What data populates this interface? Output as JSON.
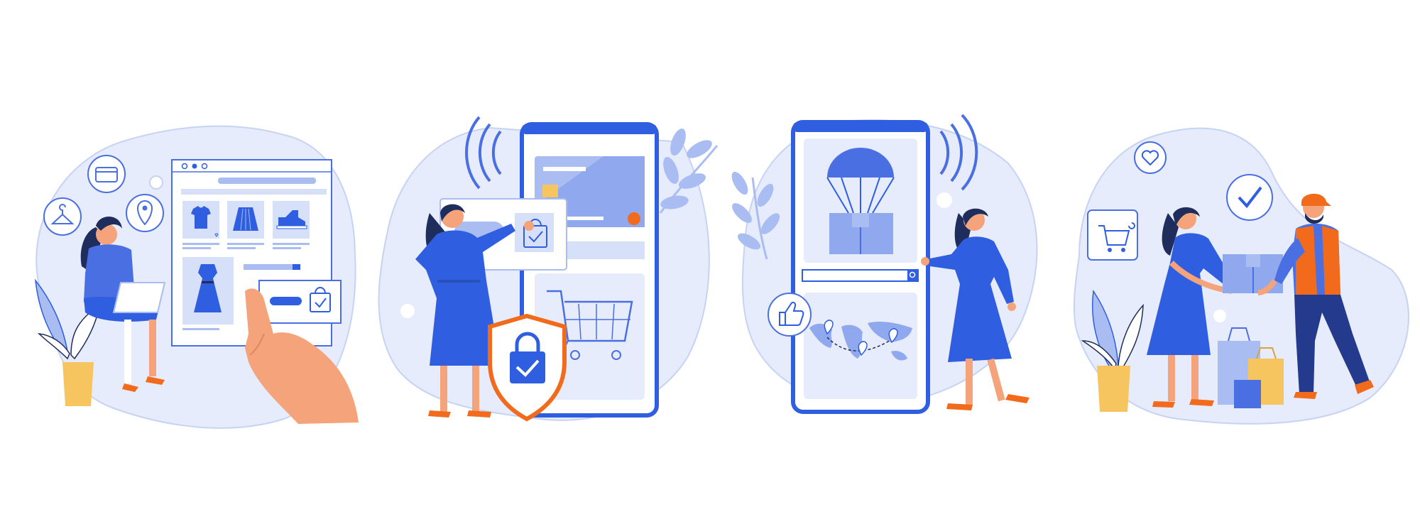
{
  "colors": {
    "background": "#ffffff",
    "blob": "#e6ecfb",
    "blob_outline": "#c7d3f3",
    "primary_blue": "#2f5fe0",
    "medium_blue": "#4a6fe3",
    "light_blue": "#a9bdf2",
    "pale_blue": "#d6e0f8",
    "skin": "#f4a37a",
    "hair": "#1f2d5c",
    "orange": "#f26a1b",
    "yellow": "#f6c560",
    "navy": "#243a8c",
    "white": "#ffffff"
  },
  "scenes": [
    {
      "id": "online-shopping",
      "icons": [
        "wallet-icon",
        "hanger-icon",
        "location-pin-icon",
        "shopping-bag-check-icon"
      ],
      "products": [
        "tshirt-icon",
        "skirt-icon",
        "sneaker-icon",
        "dress-icon"
      ]
    },
    {
      "id": "secure-payment",
      "icons": [
        "nfc-waves-icon",
        "credit-card-icon",
        "shopping-cart-icon",
        "shield-lock-icon",
        "shopping-bag-check-icon"
      ]
    },
    {
      "id": "delivery-tracking",
      "icons": [
        "parachute-parcel-icon",
        "search-icon",
        "world-map-icon",
        "thumbs-up-icon",
        "nfc-waves-icon"
      ]
    },
    {
      "id": "parcel-handover",
      "icons": [
        "heart-icon",
        "check-circle-icon",
        "shopping-cart-icon",
        "shopping-bags-icon"
      ]
    }
  ]
}
